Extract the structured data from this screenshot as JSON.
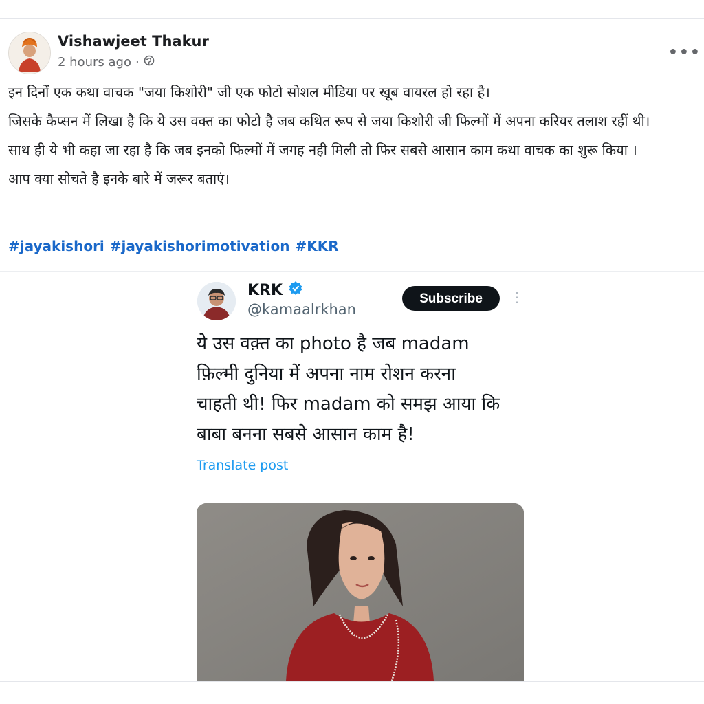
{
  "post": {
    "author": "Vishawjeet Thakur",
    "time": "2 hours ago",
    "privacy_icon": "globe-icon",
    "more_icon": "more-options-icon",
    "paragraphs": [
      "इन दिनों एक कथा वाचक \"जया किशोरी\" जी एक फोटो सोशल मीडिया पर खूब वायरल हो रहा है।",
      "जिसके कैप्सन में लिखा है कि ये उस वक्त का फोटो है जब कथित रूप से जया किशोरी जी फिल्मों में अपना करियर तलाश रहीं थी।",
      "साथ ही ये भी कहा जा रहा है कि जब इनको फिल्मों में जगह नही मिली तो फिर सबसे आसान काम कथा वाचक का शुरू किया ।",
      "आप क्या सोचते है इनके बारे में जरूर बताएं।"
    ],
    "hashtags": [
      "#jayakishori",
      "#jayakishorimotivation",
      "#KKR"
    ]
  },
  "tweet": {
    "name": "KRK",
    "verified_icon": "verified-badge-icon",
    "handle": "@kamaalrkhan",
    "subscribe_label": "Subscribe",
    "lines": [
      "ये उस वक़्त का photo है जब madam",
      "फ़िल्मी दुनिया में अपना नाम रोशन करना",
      "चाहती थी! फिर madam को समझ आया कि",
      "बाबा बनना सबसे आसान काम है!"
    ],
    "translate_label": "Translate post"
  },
  "colors": {
    "link_blue": "#1a68c9",
    "twitter_blue": "#1d9bf0",
    "subscribe_bg": "#0f1419",
    "dress_red": "#9c1f22"
  }
}
